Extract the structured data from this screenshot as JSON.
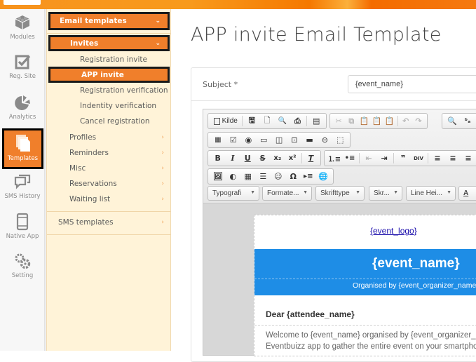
{
  "app": {
    "brand_color": "#f07f2b",
    "submenu_bg": "#fff3d8"
  },
  "rail": {
    "items": [
      {
        "label": "Modules",
        "icon": "modules-icon",
        "active": false
      },
      {
        "label": "Reg. Site",
        "icon": "checkbox-icon",
        "active": false
      },
      {
        "label": "Analytics",
        "icon": "pie-chart-icon",
        "active": false
      },
      {
        "label": "Templates",
        "icon": "templates-icon",
        "active": true
      },
      {
        "label": "SMS History",
        "icon": "chat-icon",
        "active": false
      },
      {
        "label": "Native App",
        "icon": "mobile-icon",
        "active": false
      },
      {
        "label": "Setting",
        "icon": "gears-icon",
        "active": false
      }
    ]
  },
  "submenu": {
    "email_templates": "Email templates",
    "invites": "Invites",
    "invite_items": [
      "Registration invite",
      "APP invite",
      "Registration verification",
      "Indentity verification",
      "Cancel registration"
    ],
    "categories": [
      "Profiles",
      "Reminders",
      "Misc",
      "Reservations",
      "Waiting list"
    ],
    "sms_templates": "SMS templates"
  },
  "main": {
    "title": "APP invite Email Template",
    "subject_label": "Subject *",
    "subject_value": "{event_name}"
  },
  "editor": {
    "source_label": "Kilde",
    "combos": [
      "Typografi",
      "Formate...",
      "Skrifttype",
      "Skr...",
      "Line Hei..."
    ],
    "text_color_label": "A",
    "content": {
      "logo_link": "{event_logo}",
      "event_name": "{event_name}",
      "organised_by": "Organised by {event_organizer_name}",
      "greeting": "Dear {attendee_name}",
      "body_line1": "Welcome to {event_name} organised by {event_organizer_name}",
      "body_line2": "Eventbuizz app to gather the entire event on your smartphone"
    },
    "banner_color": "#1e8de6"
  }
}
